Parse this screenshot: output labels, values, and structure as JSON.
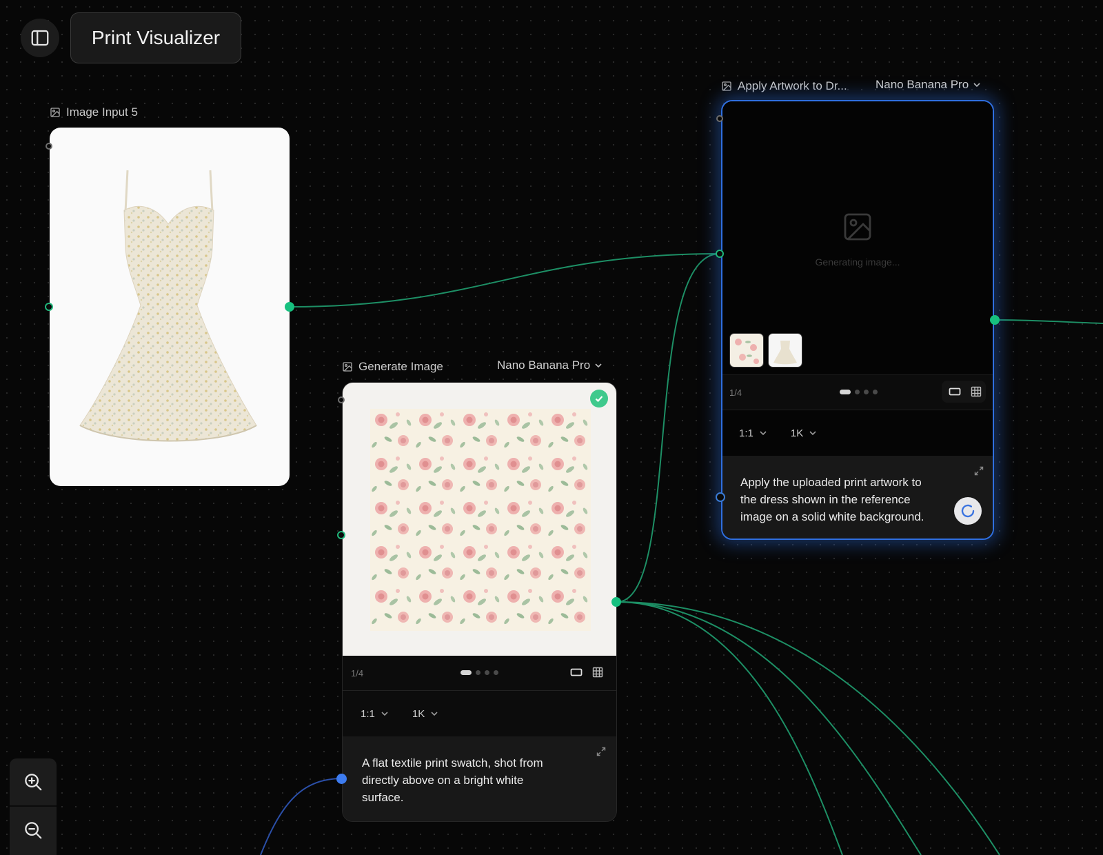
{
  "app": {
    "title": "Print Visualizer"
  },
  "nodes": {
    "image_input": {
      "title": "Image Input 5"
    },
    "generate": {
      "title": "Generate Image",
      "model": "Nano Banana Pro",
      "counter": "1/4",
      "aspect_ratio": "1:1",
      "resolution": "1K",
      "prompt": "A flat textile print swatch, shot from directly above on a bright white surface."
    },
    "apply": {
      "title": "Apply Artwork to Dr...",
      "model": "Nano Banana Pro",
      "status": "Generating image...",
      "counter": "1/4",
      "aspect_ratio": "1:1",
      "resolution": "1K",
      "prompt": "Apply the uploaded print artwork to the dress shown in the reference image on a solid white background."
    }
  },
  "icons": {
    "sidebar": "sidebar-toggle-icon",
    "image": "image-icon",
    "chevron": "chevron-down-icon",
    "check": "check-circle-icon",
    "expand": "expand-icon",
    "single_view": "single-view-icon",
    "grid_view": "grid-view-icon",
    "spinner": "loading-spinner-icon",
    "zoom_in": "zoom-in-icon",
    "zoom_out": "zoom-out-icon"
  },
  "colors": {
    "background": "#070707",
    "wire_green": "#1d8f65",
    "port_green": "#17c07f",
    "port_blue": "#3d7cf0",
    "selection_glow": "#2f6fe0"
  }
}
